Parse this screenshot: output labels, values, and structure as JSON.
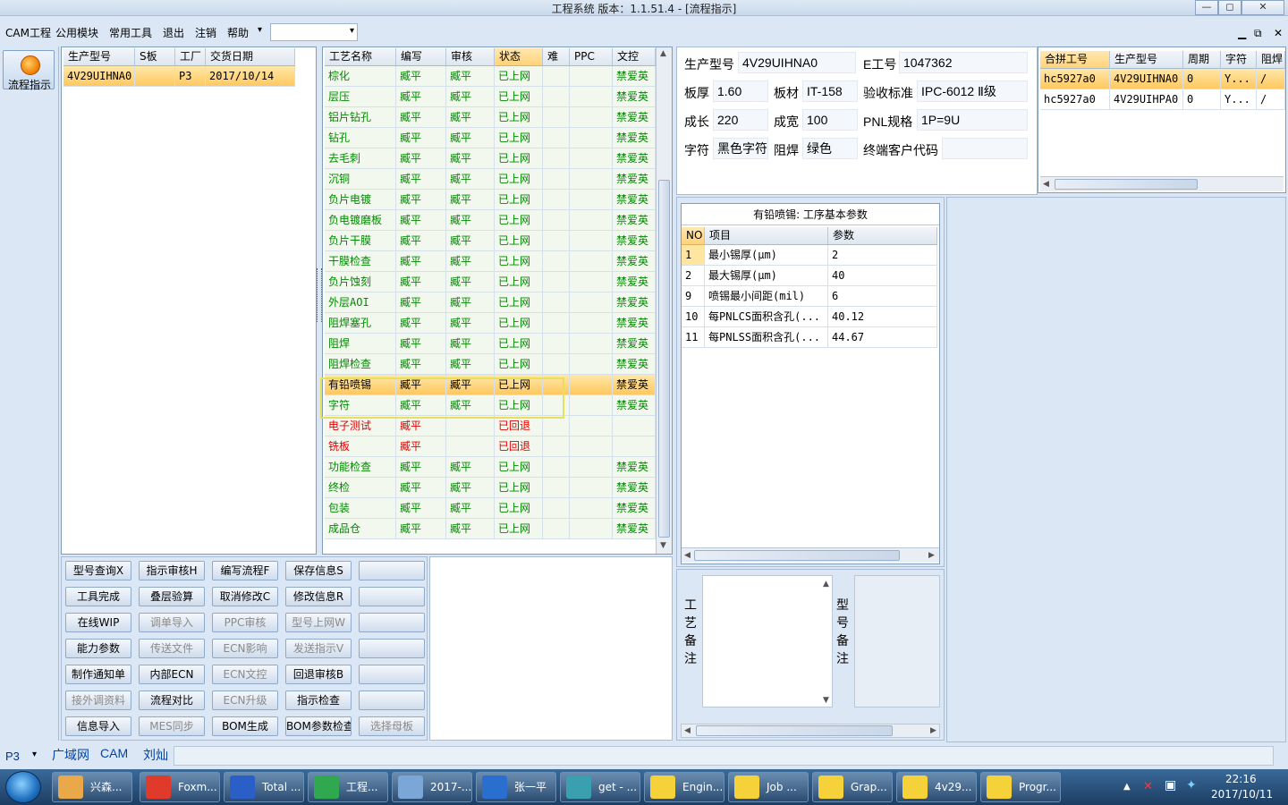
{
  "window": {
    "title": "工程系统   版本：1.1.51.4 - [流程指示]",
    "min": "—",
    "max": "◻",
    "close": "✕"
  },
  "menu": [
    "CAM工程",
    "公用模块",
    "常用工具",
    "退出",
    "注销",
    "帮助"
  ],
  "menu_help_arrow": "▾",
  "mdi": {
    "min": "▁",
    "restore": "⧉",
    "close": "✕"
  },
  "left": {
    "flow_button": "流程指示"
  },
  "orders": {
    "headers": [
      "生产型号",
      "S板",
      "工厂",
      "交货日期"
    ],
    "rows": [
      [
        "4V29UIHNA0",
        "",
        "P3",
        "2017/10/14"
      ]
    ]
  },
  "process": {
    "headers": [
      "工艺名称",
      "编写",
      "审核",
      "状态",
      "难",
      "PPC",
      "文控"
    ],
    "rows": [
      [
        "棕化",
        "臧平",
        "臧平",
        "已上网",
        "",
        "",
        "禁爱英"
      ],
      [
        "层压",
        "臧平",
        "臧平",
        "已上网",
        "",
        "",
        "禁爱英"
      ],
      [
        "铝片钻孔",
        "臧平",
        "臧平",
        "已上网",
        "",
        "",
        "禁爱英"
      ],
      [
        "钻孔",
        "臧平",
        "臧平",
        "已上网",
        "",
        "",
        "禁爱英"
      ],
      [
        "去毛刺",
        "臧平",
        "臧平",
        "已上网",
        "",
        "",
        "禁爱英"
      ],
      [
        "沉铜",
        "臧平",
        "臧平",
        "已上网",
        "",
        "",
        "禁爱英"
      ],
      [
        "负片电镀",
        "臧平",
        "臧平",
        "已上网",
        "",
        "",
        "禁爱英"
      ],
      [
        "负电镀磨板",
        "臧平",
        "臧平",
        "已上网",
        "",
        "",
        "禁爱英"
      ],
      [
        "负片干膜",
        "臧平",
        "臧平",
        "已上网",
        "",
        "",
        "禁爱英"
      ],
      [
        "干膜检查",
        "臧平",
        "臧平",
        "已上网",
        "",
        "",
        "禁爱英"
      ],
      [
        "负片蚀刻",
        "臧平",
        "臧平",
        "已上网",
        "",
        "",
        "禁爱英"
      ],
      [
        "外层AOI",
        "臧平",
        "臧平",
        "已上网",
        "",
        "",
        "禁爱英"
      ],
      [
        "阻焊塞孔",
        "臧平",
        "臧平",
        "已上网",
        "",
        "",
        "禁爱英"
      ],
      [
        "阻焊",
        "臧平",
        "臧平",
        "已上网",
        "",
        "",
        "禁爱英"
      ],
      [
        "阻焊检查",
        "臧平",
        "臧平",
        "已上网",
        "",
        "",
        "禁爱英"
      ],
      [
        "有铅喷锡",
        "臧平",
        "臧平",
        "已上网",
        "",
        "",
        "禁爱英"
      ],
      [
        "字符",
        "臧平",
        "臧平",
        "已上网",
        "",
        "",
        "禁爱英"
      ],
      [
        "电子测试",
        "臧平",
        "",
        "已回退",
        "",
        "",
        ""
      ],
      [
        "铣板",
        "臧平",
        "",
        "已回退",
        "",
        "",
        ""
      ],
      [
        "功能检查",
        "臧平",
        "臧平",
        "已上网",
        "",
        "",
        "禁爱英"
      ],
      [
        "终检",
        "臧平",
        "臧平",
        "已上网",
        "",
        "",
        "禁爱英"
      ],
      [
        "包装",
        "臧平",
        "臧平",
        "已上网",
        "",
        "",
        "禁爱英"
      ],
      [
        "成品仓",
        "臧平",
        "臧平",
        "已上网",
        "",
        "",
        "禁爱英"
      ]
    ]
  },
  "info": {
    "prod_model_label": "生产型号",
    "prod_model": "4V29UIHNA0",
    "e_no_label": "E工号",
    "e_no": "1047362",
    "thickness_label": "板厚",
    "thickness": "1.60",
    "material_label": "板材",
    "material": "IT-158",
    "standard_label": "验收标准",
    "standard": "IPC-6012 Ⅱ级",
    "length_label": "成长",
    "length": "220",
    "width_label": "成宽",
    "width": "100",
    "pnl_label": "PNL规格",
    "pnl": "1P=9U",
    "char_label": "字符",
    "char": "黑色字符",
    "mask_label": "阻焊",
    "mask": "绿色",
    "customer_label": "终端客户代码",
    "customer": ""
  },
  "merge": {
    "headers": [
      "合拼工号",
      "生产型号",
      "周期",
      "字符",
      "阻焊"
    ],
    "rows": [
      [
        "hc5927a0",
        "4V29UIHNA0",
        "0",
        "Y...",
        "/"
      ],
      [
        "hc5927a0",
        "4V29UIHPA0",
        "0",
        "Y...",
        "/"
      ]
    ]
  },
  "params": {
    "title": "有铅喷锡: 工序基本参数",
    "headers": [
      "NO",
      "项目",
      "参数"
    ],
    "rows": [
      [
        "1",
        "最小锡厚(μm)",
        "2"
      ],
      [
        "2",
        "最大锡厚(μm)",
        "40"
      ],
      [
        "9",
        "喷锡最小间距(mil)",
        "6"
      ],
      [
        "10",
        "每PNLCS面积含孔(...",
        "40.12"
      ],
      [
        "11",
        "每PNLSS面积含孔(...",
        "44.67"
      ]
    ]
  },
  "notes": {
    "process_note": "工艺备注",
    "model_note": "型号备注"
  },
  "buttons": [
    [
      "型号查询X",
      "指示审核H",
      "编写流程F",
      "保存信息S",
      ""
    ],
    [
      "工具完成",
      "叠层验算",
      "取消修改C",
      "修改信息R",
      ""
    ],
    [
      "在线WIP",
      "调单导入",
      "PPC审核",
      "型号上网W",
      ""
    ],
    [
      "能力参数",
      "传送文件",
      "ECN影响",
      "发送指示V",
      ""
    ],
    [
      "制作通知单",
      "内部ECN",
      "ECN文控",
      "回退审核B",
      ""
    ],
    [
      "接外调资料",
      "流程对比",
      "ECN升级",
      "指示检查",
      ""
    ],
    [
      "信息导入",
      "MES同步",
      "BOM生成",
      "BOM参数检查",
      "选择母板"
    ]
  ],
  "disabled_buttons": [
    "接外调资料",
    "调单导入",
    "传送文件",
    "MES同步",
    "PPC审核",
    "ECN影响",
    "ECN文控",
    "ECN升级",
    "型号上网W",
    "发送指示V",
    "选择母板"
  ],
  "status": {
    "factory": "P3",
    "tabs": [
      "广域网",
      "CAM",
      "刘灿"
    ]
  },
  "taskbar": {
    "items": [
      "兴森...",
      "Foxm...",
      "Total ...",
      "工程...",
      "2017-...",
      "张一平",
      "get - ...",
      "Engin...",
      "Job ...",
      "Grap...",
      "4v29...",
      "Progr..."
    ],
    "time": "22:16",
    "date": "2017/10/11"
  }
}
